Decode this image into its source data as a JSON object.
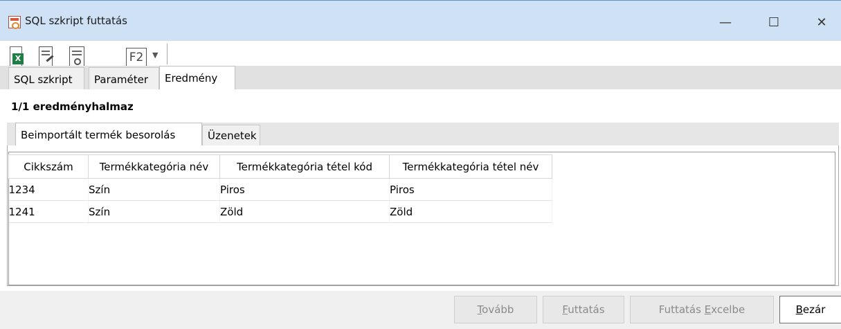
{
  "window": {
    "title": "SQL szkript futtatás",
    "min_glyph": "—",
    "max_glyph": "☐",
    "close_glyph": "✕"
  },
  "toolbar": {
    "icons": [
      "excel-export-icon",
      "edit-script-icon",
      "run-script-icon",
      "f2-key-icon",
      "dropdown-arrow-icon"
    ],
    "f2_label": "F2",
    "dropdown_glyph": "▼"
  },
  "tabs": [
    {
      "label": "SQL szkript",
      "active": false
    },
    {
      "label": "Paraméter",
      "active": false
    },
    {
      "label": "Eredmény",
      "active": true
    }
  ],
  "result": {
    "resultset_label": "1/1 eredményhalmaz",
    "subtabs": [
      {
        "label": "Beimportált termék besorolás",
        "active": true
      },
      {
        "label": "Üzenetek",
        "active": false
      }
    ],
    "columns": [
      "Cikkszám",
      "Termékkategória név",
      "Termékkategória tétel kód",
      "Termékkategória tétel név"
    ],
    "rows": [
      [
        "1234",
        "Szín",
        "Piros",
        "Piros"
      ],
      [
        "1241",
        "Szín",
        "Zöld",
        "Zöld"
      ]
    ]
  },
  "footer": {
    "buttons": [
      {
        "pre": "",
        "key": "T",
        "post": "ovább",
        "enabled": false
      },
      {
        "pre": "",
        "key": "F",
        "post": "uttatás",
        "enabled": false
      },
      {
        "pre": "Futtatás ",
        "key": "E",
        "post": "xcelbe",
        "enabled": false
      },
      {
        "pre": "",
        "key": "B",
        "post": "ezár",
        "enabled": true
      }
    ]
  },
  "colors": {
    "titlebar_bg": "#cfe1f5",
    "excel_green": "#1e7e45",
    "disabled_text": "#8a8a8a"
  }
}
